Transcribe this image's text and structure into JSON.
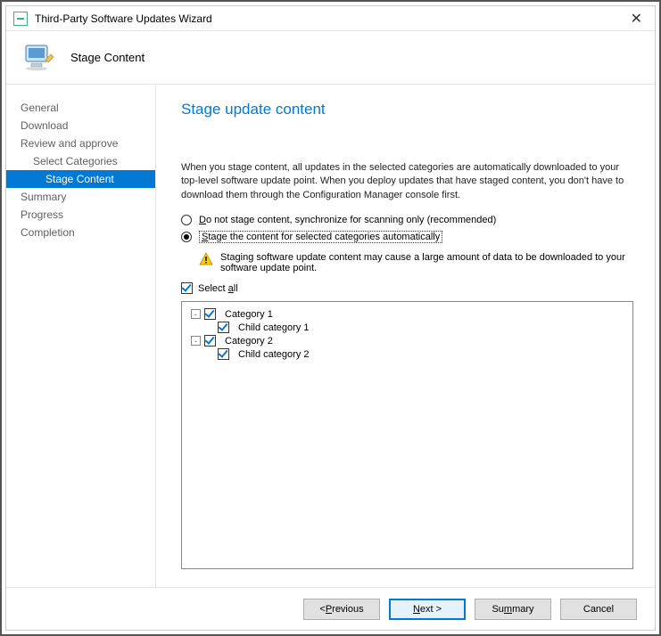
{
  "window": {
    "title": "Third-Party Software Updates Wizard",
    "close_glyph": "✕"
  },
  "header": {
    "label": "Stage Content"
  },
  "sidebar": {
    "items": [
      {
        "label": "General",
        "indent": 0,
        "selected": false
      },
      {
        "label": "Download",
        "indent": 0,
        "selected": false
      },
      {
        "label": "Review and approve",
        "indent": 0,
        "selected": false
      },
      {
        "label": "Select Categories",
        "indent": 1,
        "selected": false
      },
      {
        "label": "Stage Content",
        "indent": 2,
        "selected": true
      },
      {
        "label": "Summary",
        "indent": 0,
        "selected": false
      },
      {
        "label": "Progress",
        "indent": 0,
        "selected": false
      },
      {
        "label": "Completion",
        "indent": 0,
        "selected": false
      }
    ]
  },
  "main": {
    "title": "Stage update content",
    "intro": "When you stage content, all updates in the selected categories are automatically downloaded to your top-level software update point. When you deploy updates that have staged content, you don't have to download them through the Configuration Manager console first.",
    "radio1_prefix": "D",
    "radio1_rest": "o not stage content, synchronize for scanning only (recommended)",
    "radio2_prefix": "S",
    "radio2_rest": "tage the content for selected categories automatically",
    "warning": "Staging software update content may cause a large amount of data to be downloaded to your software update point.",
    "select_all_prefix": "Select ",
    "select_all_underline": "a",
    "select_all_rest": "ll",
    "tree": [
      {
        "label": "Category 1",
        "level": 0,
        "checked": true,
        "expander": "-"
      },
      {
        "label": "Child category 1",
        "level": 1,
        "checked": true,
        "expander": ""
      },
      {
        "label": "Category 2",
        "level": 0,
        "checked": true,
        "expander": "-"
      },
      {
        "label": "Child category 2",
        "level": 1,
        "checked": true,
        "expander": ""
      }
    ]
  },
  "footer": {
    "previous_prefix": "< ",
    "previous_underline": "P",
    "previous_rest": "revious",
    "next_underline": "N",
    "next_rest": "ext >",
    "summary_prefix": "Su",
    "summary_underline": "m",
    "summary_rest": "mary",
    "cancel": "Cancel"
  }
}
